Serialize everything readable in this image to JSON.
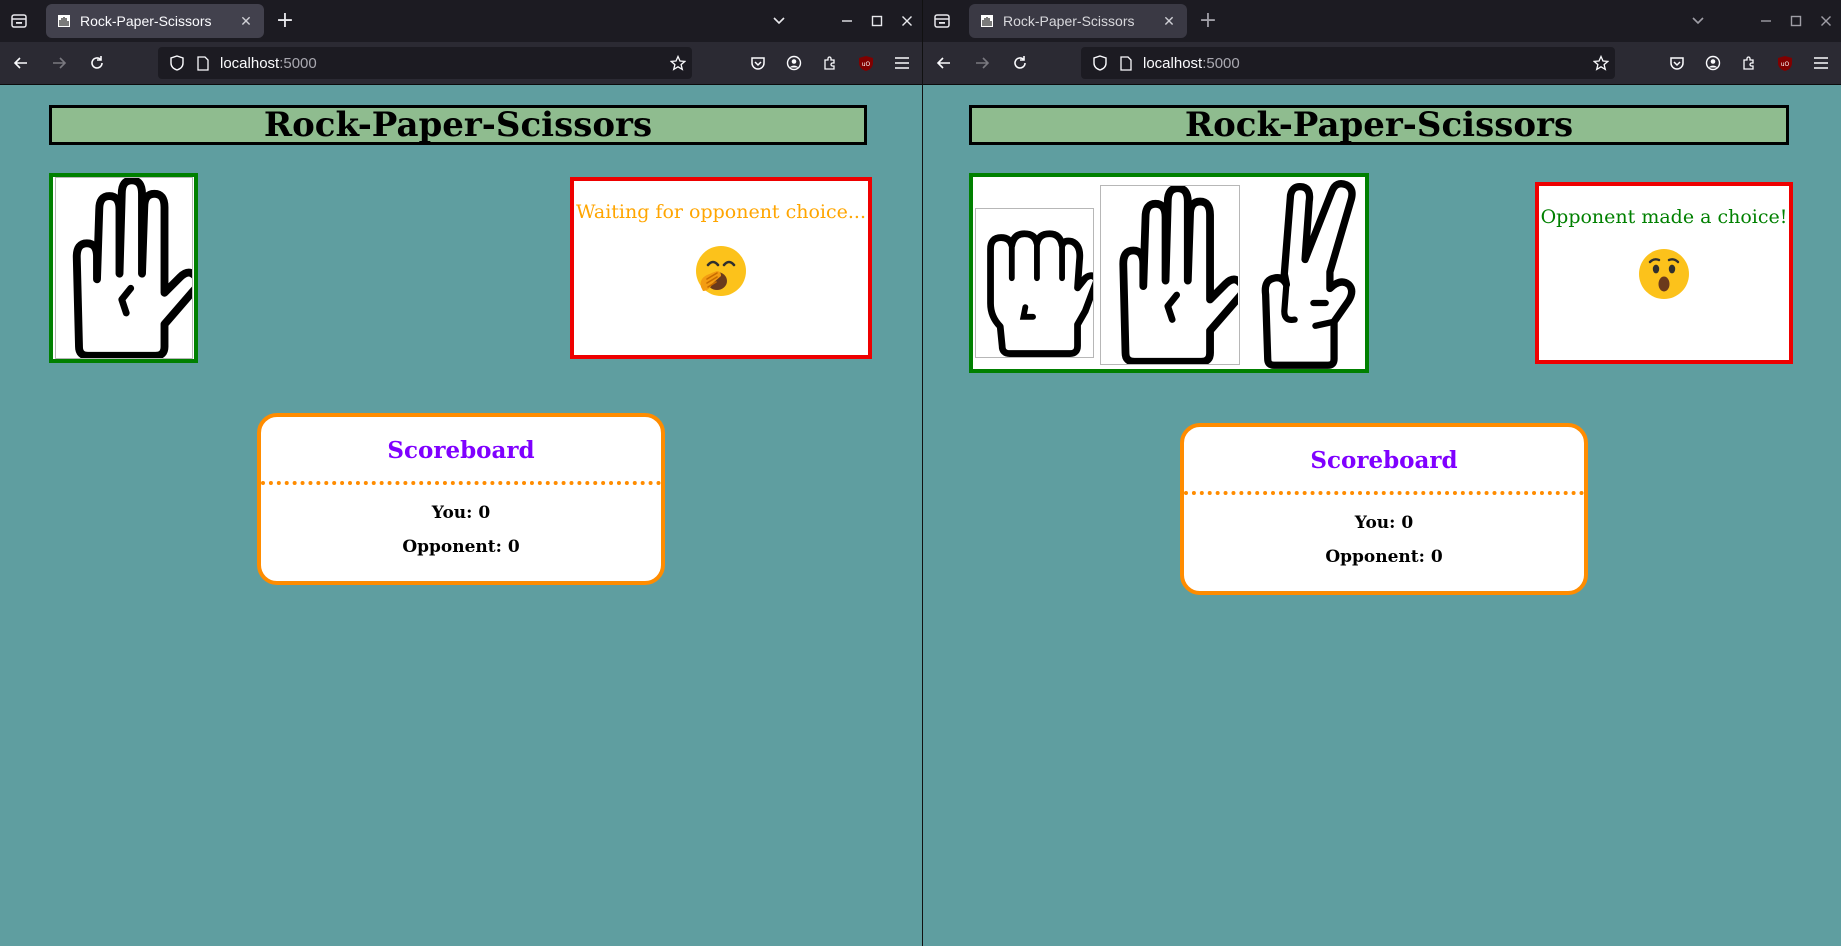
{
  "windows": [
    {
      "tab_title": "Rock-Paper-Scissors",
      "url_host": "localhost",
      "url_port": ":5000",
      "heading": "Rock-Paper-Scissors",
      "your_choices": [
        "paper"
      ],
      "status": {
        "text": "Waiting for opponent choice...",
        "color": "#ffa500",
        "emoji": "yawning-face"
      },
      "scoreboard": {
        "title": "Scoreboard",
        "you": "You: 0",
        "opponent": "Opponent: 0"
      }
    },
    {
      "tab_title": "Rock-Paper-Scissors",
      "url_host": "localhost",
      "url_port": ":5000",
      "heading": "Rock-Paper-Scissors",
      "your_choices": [
        "rock",
        "paper",
        "scissors"
      ],
      "status": {
        "text": "Opponent made a choice!",
        "color": "#008000",
        "emoji": "astonished-face"
      },
      "scoreboard": {
        "title": "Scoreboard",
        "you": "You: 0",
        "opponent": "Opponent: 0"
      }
    }
  ],
  "colors": {
    "page_background": "#5f9ea0",
    "heading_background": "#8fbc8f",
    "choice_border": "#008000",
    "status_border": "#ee0000",
    "scoreboard_border": "#ff8c00",
    "scoreboard_title": "#7f00ff"
  }
}
